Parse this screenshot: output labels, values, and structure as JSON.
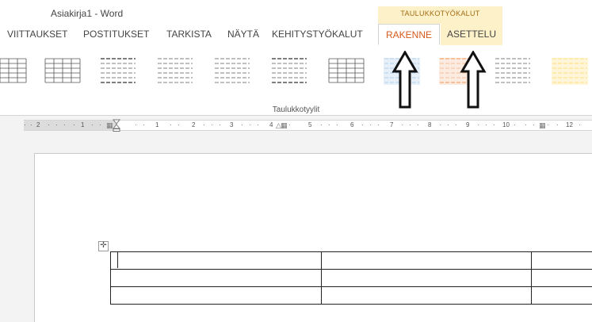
{
  "window": {
    "title": "Asiakirja1 - Word"
  },
  "contextual": {
    "label": "TAULUKKOTYÖKALUT"
  },
  "tabs": [
    {
      "label": "VIITTAUKSET"
    },
    {
      "label": "POSTITUKSET"
    },
    {
      "label": "TARKISTA"
    },
    {
      "label": "NÄYTÄ"
    },
    {
      "label": "KEHITYSTYÖKALUT"
    },
    {
      "label": "RAKENNE"
    },
    {
      "label": "ASETTELU"
    }
  ],
  "ribbon": {
    "group_label": "Taulukkotyylit",
    "table_styles": [
      {
        "name": "style-1",
        "color": "#555555"
      },
      {
        "name": "style-2",
        "color": "#555555"
      },
      {
        "name": "style-3",
        "color": "#555555"
      },
      {
        "name": "style-4",
        "color": "#555555"
      },
      {
        "name": "style-5",
        "color": "#555555"
      },
      {
        "name": "style-6",
        "color": "#555555"
      },
      {
        "name": "style-7",
        "color": "#555555"
      },
      {
        "name": "style-8-blue",
        "color": "#9ec3e6"
      },
      {
        "name": "style-9-orange",
        "color": "#f4b183"
      },
      {
        "name": "style-10",
        "color": "#555555"
      },
      {
        "name": "style-11-yellow",
        "color": "#ffd966"
      }
    ]
  },
  "ruler": {
    "numbers": [
      "2",
      "1",
      "1",
      "2",
      "3",
      "4",
      "5",
      "6",
      "7",
      "8",
      "9",
      "10",
      "12"
    ]
  },
  "colors": {
    "accent": "#d65a1c",
    "contextual_bg": "#fdf1c9",
    "contextual_text": "#a46b12"
  }
}
